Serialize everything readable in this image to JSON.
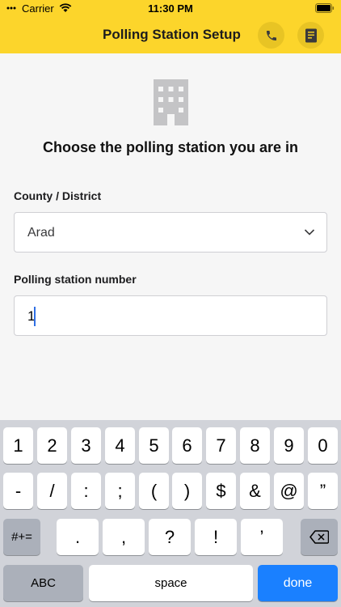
{
  "status": {
    "carrier": "Carrier",
    "time": "11:30 PM"
  },
  "nav": {
    "title": "Polling Station Setup",
    "phone_icon": "phone-icon",
    "notes_icon": "notes-icon"
  },
  "main": {
    "icon": "building-icon",
    "heading": "Choose the polling station you are in",
    "county_label": "County / District",
    "county_value": "Arad",
    "station_label": "Polling station number",
    "station_value": "1"
  },
  "keyboard": {
    "row1": [
      "1",
      "2",
      "3",
      "4",
      "5",
      "6",
      "7",
      "8",
      "9",
      "0"
    ],
    "row2": [
      "-",
      "/",
      ":",
      ";",
      "(",
      ")",
      "$",
      "&",
      "@",
      "”"
    ],
    "row3": {
      "symbols": "#+=",
      "keys": [
        ".",
        ",",
        "?",
        "!",
        "’"
      ],
      "backspace_icon": "backspace-icon"
    },
    "row4": {
      "abc": "ABC",
      "space": "space",
      "done": "done"
    }
  },
  "colors": {
    "accent": "#fcd52b",
    "keyboard_bg": "#d1d3d9",
    "done_key": "#1a80ff"
  }
}
